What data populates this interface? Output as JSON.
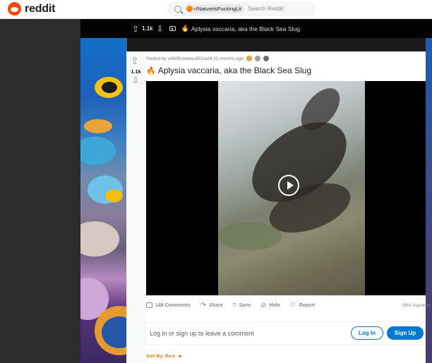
{
  "header": {
    "logo_text": "reddit",
    "subreddit_chip": "r/NatureIsFuckingLit",
    "search_placeholder": "Search Reddit"
  },
  "post_bar": {
    "score": "1.1k",
    "title": "Aplysia vaccaria, aka the Black Sea Slug"
  },
  "post": {
    "score": "1.1k",
    "meta": "Posted by u/MrBonelessPizza24 11 months ago",
    "title": "Aplysia vaccaria, aka the Black Sea Slug",
    "actions": {
      "comments": "148 Comments",
      "share": "Share",
      "save": "Save",
      "hide": "Hide",
      "report": "Report"
    },
    "upvoted": "99% Upvoted"
  },
  "comment_prompt": {
    "text": "Log in or sign up to leave a comment",
    "login": "Log In",
    "signup": "Sign Up"
  },
  "sort": {
    "label": "Sort By: Best"
  },
  "icons": [
    "reddit-logo-icon",
    "search-icon",
    "upvote-icon",
    "downvote-icon",
    "media-icon",
    "fire-icon",
    "award-icon",
    "play-icon",
    "comment-icon",
    "share-icon",
    "save-icon",
    "hide-icon",
    "report-icon",
    "chevron-down-icon"
  ],
  "colors": {
    "brand": "#ff4500",
    "accent": "#0079d3",
    "sort": "#d97c1b"
  }
}
